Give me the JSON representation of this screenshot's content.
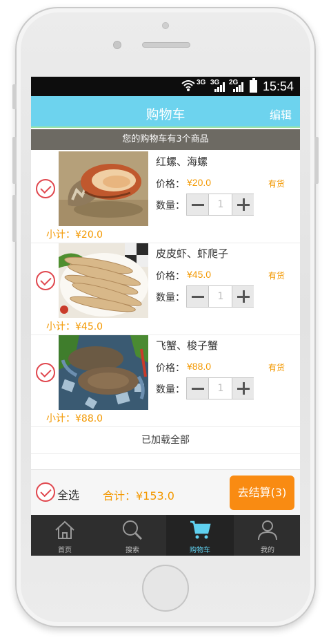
{
  "statusbar": {
    "net1": "3G",
    "net2": "3G",
    "net3": "2G",
    "time": "15:54"
  },
  "header": {
    "title": "购物车",
    "edit_label": "编辑"
  },
  "notice": "您的购物车有3个商品",
  "labels": {
    "price": "价格：",
    "quantity": "数量：",
    "stock": "有货"
  },
  "items": [
    {
      "name": "红螺、海螺",
      "price": "¥20.0",
      "quantity": "1",
      "subtotal": "小计：¥20.0",
      "image": "conch-shell"
    },
    {
      "name": "皮皮虾、虾爬子",
      "price": "¥45.0",
      "quantity": "1",
      "subtotal": "小计：¥45.0",
      "image": "mantis-shrimp"
    },
    {
      "name": "飞蟹、梭子蟹",
      "price": "¥88.0",
      "quantity": "1",
      "subtotal": "小计：¥88.0",
      "image": "swimming-crab"
    }
  ],
  "loaded_text": "已加载全部",
  "footer": {
    "select_all": "全选",
    "total": "合计：¥153.0",
    "checkout": "去结算(3)"
  },
  "tabs": [
    {
      "label": "首页",
      "icon": "home-icon"
    },
    {
      "label": "搜索",
      "icon": "search-icon"
    },
    {
      "label": "购物车",
      "icon": "cart-icon",
      "active": true
    },
    {
      "label": "我的",
      "icon": "user-icon"
    }
  ],
  "colors": {
    "header": "#6dd3ee",
    "accent": "#f39800",
    "checkout": "#f98b12",
    "check": "#e0464d",
    "tab_active": "#5fd0ef"
  }
}
